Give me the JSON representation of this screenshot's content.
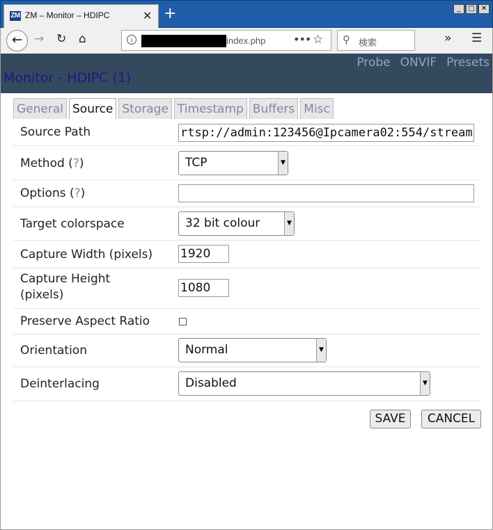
{
  "browser": {
    "tab_title": "ZM – Monitor – HDIPC",
    "tab_favicon_text": "ZM",
    "tab_close": "✕",
    "new_tab": "+",
    "url_suffix": "index.php",
    "search_placeholder": "検索"
  },
  "header": {
    "links": [
      "Probe",
      "ONVIF",
      "Presets"
    ],
    "title": "Monitor - HDIPC (1)"
  },
  "tabs": [
    "General",
    "Source",
    "Storage",
    "Timestamp",
    "Buffers",
    "Misc"
  ],
  "active_tab": "Source",
  "form": {
    "source_path": {
      "label": "Source Path",
      "value": "rtsp://admin:123456@Ipcamera02:554/stream"
    },
    "method": {
      "label": "Method",
      "help": "?",
      "value": "TCP"
    },
    "options": {
      "label": "Options",
      "help": "?",
      "value": ""
    },
    "target_colorspace": {
      "label": "Target colorspace",
      "value": "32 bit colour"
    },
    "capture_width": {
      "label": "Capture Width (pixels)",
      "value": "1920"
    },
    "capture_height": {
      "label_line1": "Capture Height",
      "label_line2": "(pixels)",
      "value": "1080"
    },
    "preserve_aspect": {
      "label": "Preserve Aspect Ratio",
      "checked": false
    },
    "orientation": {
      "label": "Orientation",
      "value": "Normal"
    },
    "deinterlacing": {
      "label": "Deinterlacing",
      "value": "Disabled"
    }
  },
  "buttons": {
    "save": "SAVE",
    "cancel": "CANCEL"
  }
}
